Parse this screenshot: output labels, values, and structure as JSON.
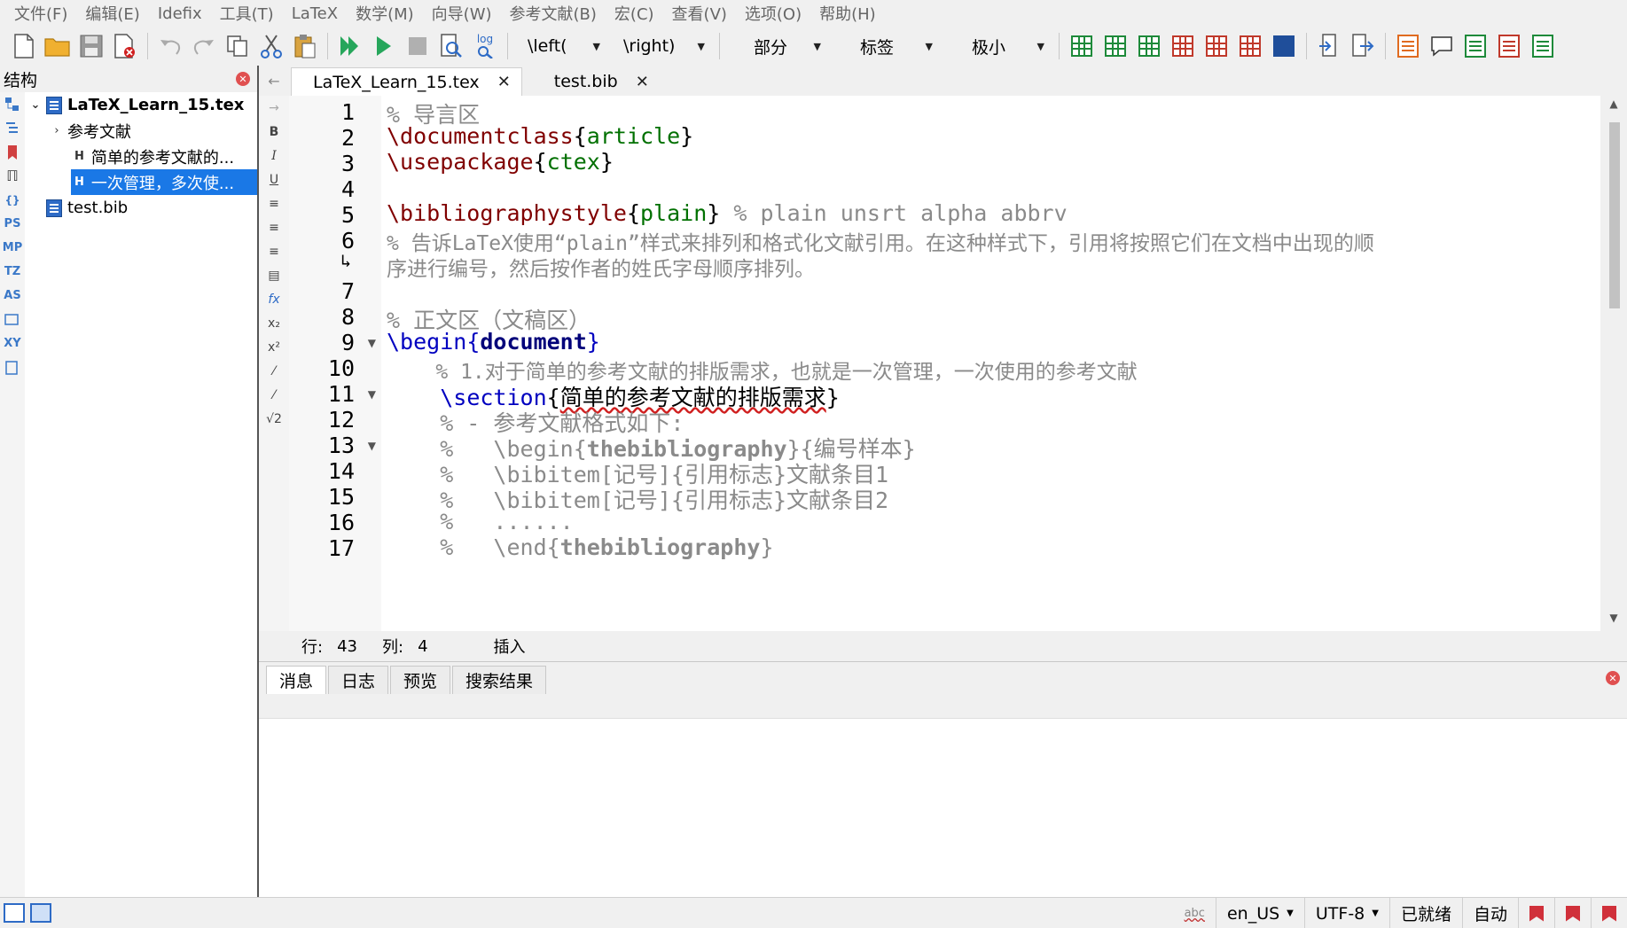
{
  "menu": [
    "文件(F)",
    "编辑(E)",
    "Idefix",
    "工具(T)",
    "LaTeX",
    "数学(M)",
    "向导(W)",
    "参考文献(B)",
    "宏(C)",
    "查看(V)",
    "选项(O)",
    "帮助(H)"
  ],
  "toolbar": {
    "left_combo": "\\left(",
    "right_combo": "\\right)",
    "section_combo": "部分",
    "label_combo": "标签",
    "size_combo": "极小",
    "log_label": "log"
  },
  "structure": {
    "title": "结构",
    "root_file": "LaTeX_Learn_15.tex",
    "items": [
      {
        "label": "参考文献",
        "type": "folder"
      },
      {
        "label": "简单的参考文献的...",
        "type": "section"
      },
      {
        "label": "一次管理，多次使...",
        "type": "section",
        "selected": true
      }
    ],
    "bib_file": "test.bib"
  },
  "side_icons": [
    "PS",
    "MP",
    "TZ",
    "AS",
    "XY"
  ],
  "format_icons": [
    "B",
    "I",
    "U",
    "fx",
    "x₂",
    "x²",
    "√2"
  ],
  "tabs": [
    {
      "label": "LaTeX_Learn_15.tex",
      "active": true
    },
    {
      "label": "test.bib",
      "active": false
    }
  ],
  "editor": {
    "line_numbers": [
      "1",
      "2",
      "3",
      "4",
      "5",
      "6",
      "",
      "7",
      "8",
      "9",
      "10",
      "11",
      "12",
      "13",
      "14",
      "15",
      "16",
      "17"
    ],
    "lines": {
      "l1": "% 导言区",
      "l2_cmd": "\\documentclass",
      "l2_arg": "article",
      "l3_cmd": "\\usepackage",
      "l3_arg": "ctex",
      "l5_cmd": "\\bibliographystyle",
      "l5_arg": "plain",
      "l5_comment": " % plain unsrt alpha abbrv",
      "l6a": "% 告诉LaTeX使用“plain”样式来排列和格式化文献引用。在这种样式下，引用将按照它们在文档中出现的顺",
      "l6b": "序进行编号，然后按作者的姓氏字母顺序排列。",
      "l8": "% 正文区（文稿区）",
      "l9_cmd": "\\begin",
      "l9_arg": "document",
      "l10": "    % 1.对于简单的参考文献的排版需求，也就是一次管理，一次使用的参考文献",
      "l11_cmd": "\\section",
      "l11_arg": "简单的参考文献的排版需求",
      "l12": "    % - 参考文献格式如下:",
      "l13_pre": "    %   \\begin{",
      "l13_bold": "thebibliography",
      "l13_post": "}{编号样本}",
      "l14": "    %   \\bibitem[记号]{引用标志}文献条目1",
      "l15": "    %   \\bibitem[记号]{引用标志}文献条目2",
      "l16": "    %   ......",
      "l17_pre": "    %   \\end{",
      "l17_bold": "thebibliography",
      "l17_post": "}"
    }
  },
  "status": {
    "row_label": "行:",
    "row_value": "43",
    "col_label": "列:",
    "col_value": "4",
    "mode": "插入"
  },
  "message_tabs": [
    "消息",
    "日志",
    "预览",
    "搜索结果"
  ],
  "statusbar": {
    "abc": "abc",
    "language": "en_US",
    "encoding": "UTF-8",
    "state": "已就绪",
    "auto": "自动"
  }
}
